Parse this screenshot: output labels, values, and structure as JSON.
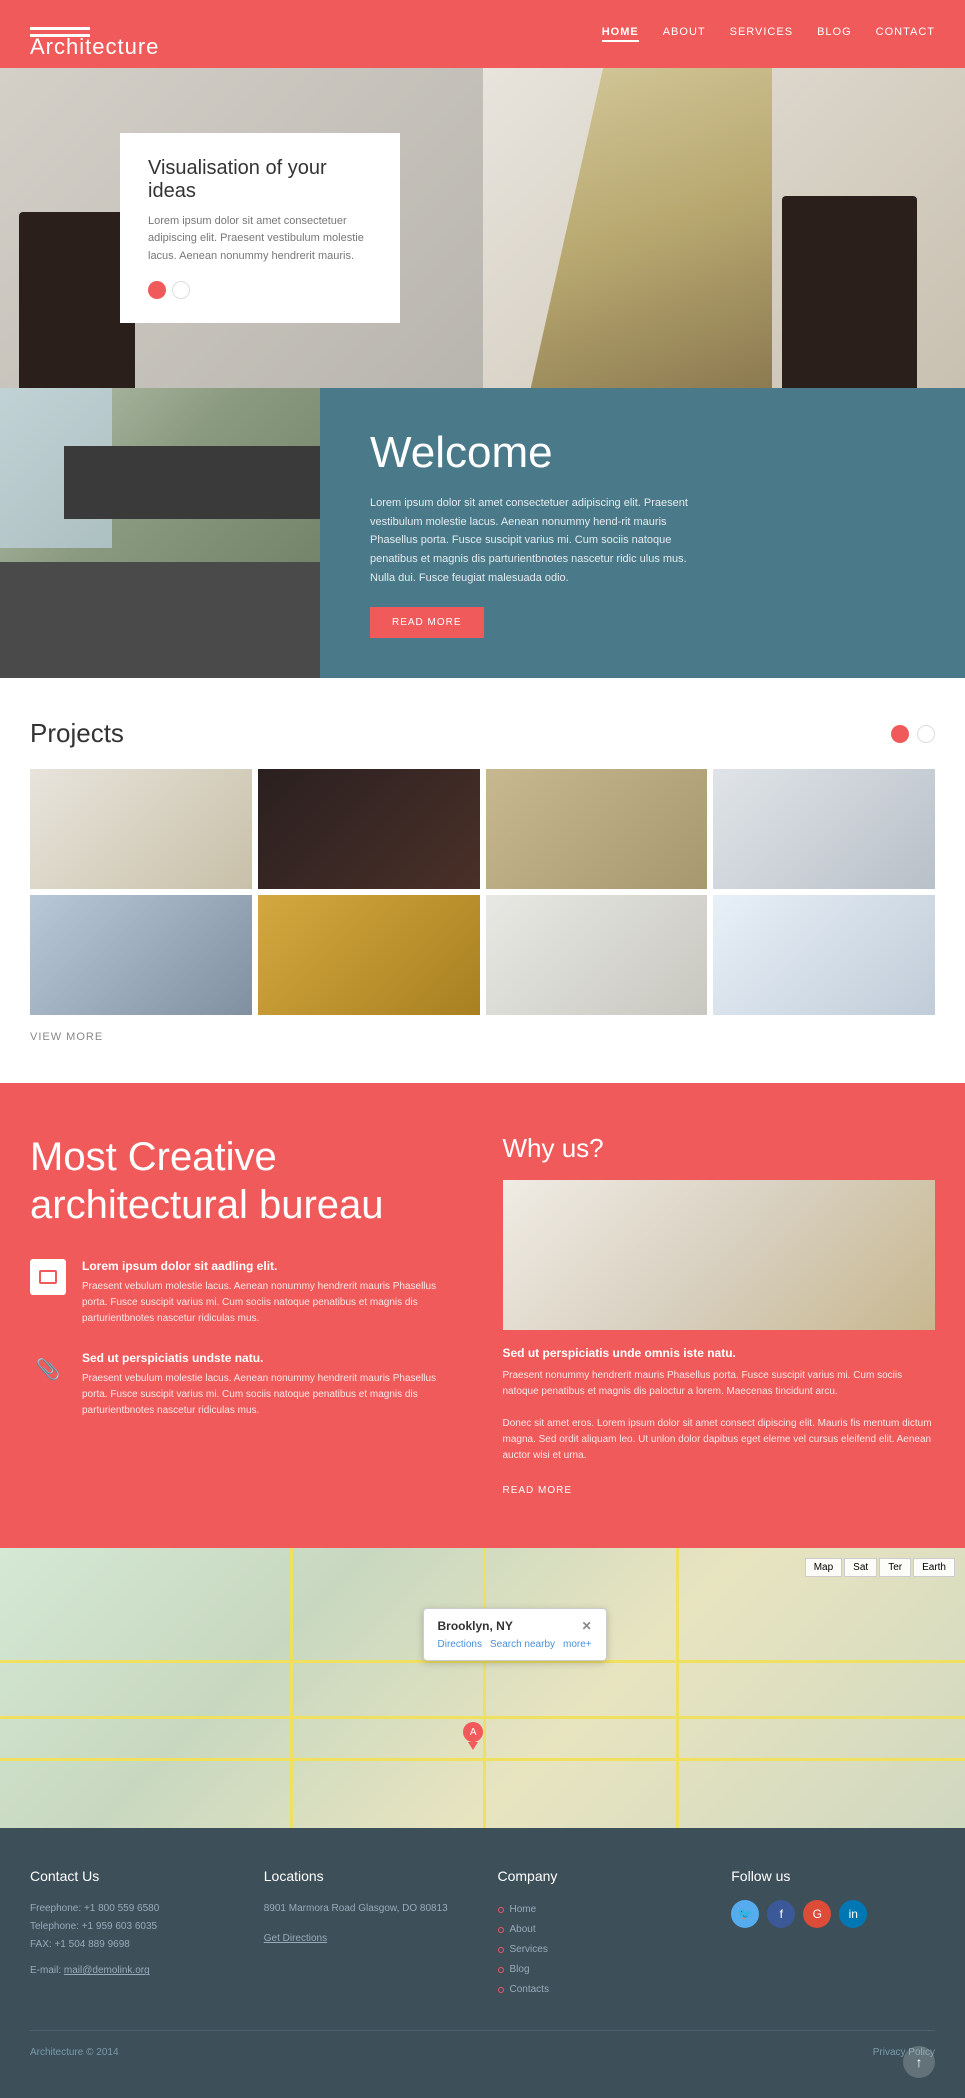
{
  "header": {
    "logo": "Architecture",
    "logo_bar": "",
    "nav": [
      {
        "label": "HOME",
        "active": true
      },
      {
        "label": "ABOUT",
        "active": false
      },
      {
        "label": "SERVICES",
        "active": false
      },
      {
        "label": "BLOG",
        "active": false
      },
      {
        "label": "CONTACT",
        "active": false
      }
    ]
  },
  "hero": {
    "title": "Visualisation of your ideas",
    "text": "Lorem ipsum dolor sit amet consectetuer adipiscing elit. Praesent vestibulum molestie lacus. Aenean nonummy hendrerit mauris."
  },
  "welcome": {
    "title": "Welcome",
    "text": "Lorem ipsum dolor sit amet consectetuer adipiscing elit. Praesent vestibulum molestie lacus. Aenean nonummy hend-rit mauris Phasellus porta. Fusce suscipit varius mi. Cum sociis natoque penatibus et magnis dis parturientbnotes nascetur ridic ulus mus. Nulla dui. Fusce feugiat malesuada odio.",
    "button": "READ MORE"
  },
  "projects": {
    "title": "Projects",
    "view_more": "VIEW MORE",
    "items": [
      {
        "id": 1,
        "style": "proj-1"
      },
      {
        "id": 2,
        "style": "proj-2"
      },
      {
        "id": 3,
        "style": "proj-3"
      },
      {
        "id": 4,
        "style": "proj-4"
      },
      {
        "id": 5,
        "style": "proj-5"
      },
      {
        "id": 6,
        "style": "proj-6"
      },
      {
        "id": 7,
        "style": "proj-7"
      },
      {
        "id": 8,
        "style": "proj-8"
      }
    ]
  },
  "creative": {
    "title": "Most Creative architectural bureau",
    "feature1_title": "Lorem ipsum dolor sit aadling elit.",
    "feature1_text": "Praesent vebulum molestie lacus. Aenean nonummy hendrerit mauris Phasellus porta. Fusce suscipit varius mi. Cum sociis natoque penatibus et magnis dis parturientbnotes nascetur ridiculas mus.",
    "feature2_title": "Sed ut perspiciatis undste natu.",
    "feature2_text": "Praesent vebulum molestie lacus. Aenean nonummy hendrerit mauris Phasellus porta. Fusce suscipit varius mi. Cum sociis natoque penatibus et magnis dis parturientbnotes nascetur ridiculas mus."
  },
  "whyus": {
    "title": "Why us?",
    "subtitle": "Sed ut perspiciatis unde omnis iste natu.",
    "text1": "Praesent nonummy hendrerit mauris Phasellus porta. Fusce suscipit varius mi. Cum sociis natoque penatibus et magnis dis paloctur a lorem. Maecenas tincidunt arcu.",
    "text2": "Donec sit amet eros. Lorem ipsum dolor sit amet consect dipiscing elit. Mauris fis mentum dictum magna. Sed ordit aliquam leo. Ut unlon dolor dapibus eget eleme vel cursus eleifend elit. Aenean auctor wisi et urna.",
    "read_more": "READ MORE"
  },
  "map": {
    "popup_title": "Brooklyn, NY",
    "directions": "Directions",
    "search_nearby": "Search nearby",
    "more": "more+"
  },
  "footer": {
    "contact_title": "Contact Us",
    "freephone_label": "Freephone:",
    "freephone": "+1 800 559 6580",
    "telephone_label": "Telephone:",
    "telephone": "+1 959 603 6035",
    "fax_label": "FAX:",
    "fax": "+1 504 889 9698",
    "email_label": "E-mail:",
    "email": "mail@demolink.org",
    "locations_title": "Locations",
    "address": "8901 Marmora Road Glasgow, DO 80813",
    "get_directions": "Get Directions",
    "company_title": "Company",
    "company_links": [
      "Home",
      "About",
      "Services",
      "Blog",
      "Contacts"
    ],
    "follow_title": "Follow us",
    "copyright": "Architecture © 2014",
    "privacy": "Privacy Policy"
  }
}
